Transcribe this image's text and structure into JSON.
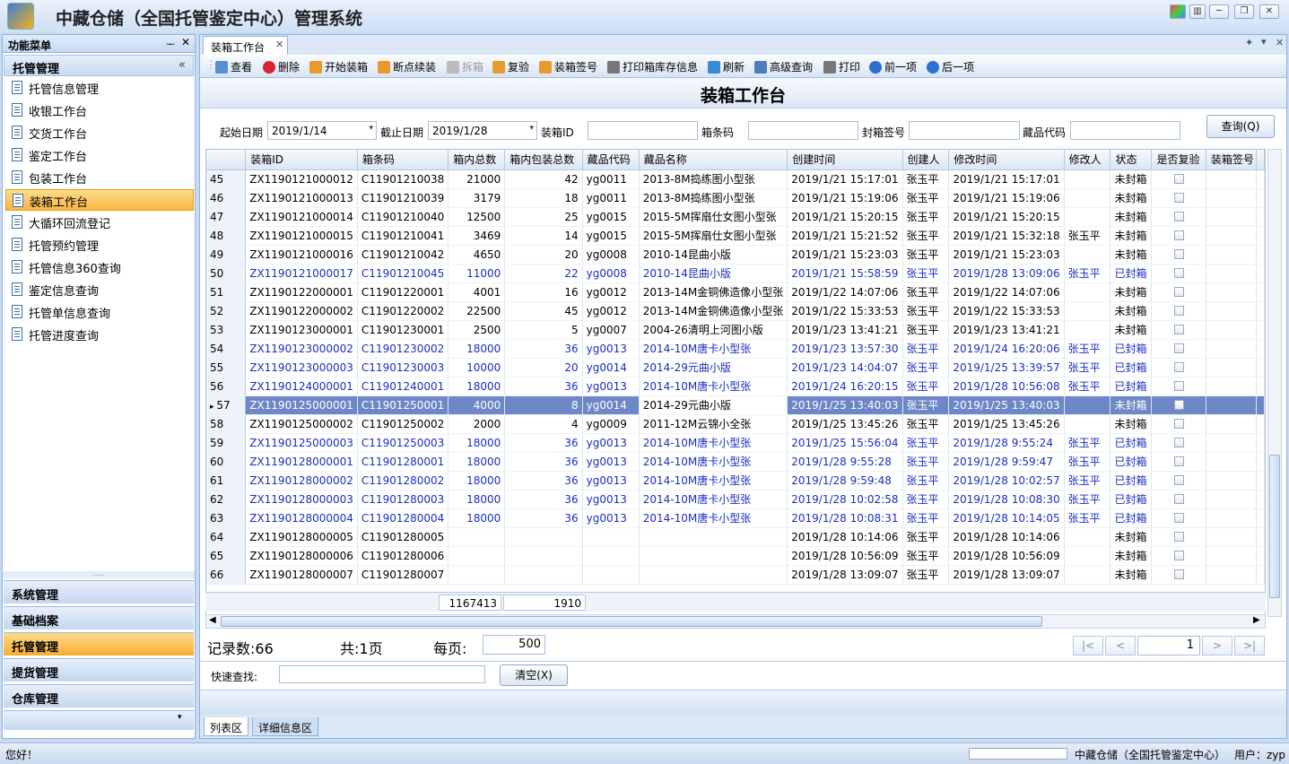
{
  "window": {
    "title": "中藏仓储（全国托管鉴定中心）管理系统"
  },
  "left_panel": {
    "header": "功能菜单",
    "group": "托管管理",
    "items": [
      "托管信息管理",
      "收银工作台",
      "交货工作台",
      "鉴定工作台",
      "包装工作台",
      "装箱工作台",
      "大循环回流登记",
      "托管预约管理",
      "托管信息360查询",
      "鉴定信息查询",
      "托管单信息查询",
      "托管进度查询"
    ],
    "active_index": 5,
    "bottom_groups": [
      "系统管理",
      "基础档案",
      "托管管理",
      "提货管理",
      "仓库管理"
    ]
  },
  "doc_tab": {
    "label": "装箱工作台"
  },
  "toolbar": {
    "query": "查看",
    "delete": "删除",
    "start": "开始装箱",
    "resume": "断点续装",
    "unpack": "拆箱",
    "recheck": "复验",
    "seal": "装箱签号",
    "print_stock": "打印箱库存信息",
    "refresh": "刷新",
    "advanced": "高级查询",
    "print": "打印",
    "prev": "前一项",
    "next": "后一项"
  },
  "heading": "装箱工作台",
  "filters": {
    "start_label": "起始日期",
    "start_value": "2019/1/14",
    "end_label": "截止日期",
    "end_value": "2019/1/28",
    "box_id_label": "装箱ID",
    "barcode_label": "箱条码",
    "seal_label": "封箱签号",
    "code_label": "藏品代码",
    "query_button": "查询(Q)"
  },
  "table": {
    "columns": [
      "装箱ID",
      "箱条码",
      "箱内总数",
      "箱内包装总数",
      "藏品代码",
      "藏品名称",
      "创建时间",
      "创建人",
      "修改时间",
      "修改人",
      "状态",
      "是否复验",
      "装箱签号"
    ],
    "rows": [
      [
        "45",
        "ZX1190121000012",
        "C11901210038",
        "21000",
        "42",
        "yg0011",
        "2013-8M捣练图小型张",
        "2019/1/21 15:17:01",
        "张玉平",
        "2019/1/21 15:17:01",
        "",
        "未封箱"
      ],
      [
        "46",
        "ZX1190121000013",
        "C11901210039",
        "3179",
        "18",
        "yg0011",
        "2013-8M捣练图小型张",
        "2019/1/21 15:19:06",
        "张玉平",
        "2019/1/21 15:19:06",
        "",
        "未封箱"
      ],
      [
        "47",
        "ZX1190121000014",
        "C11901210040",
        "12500",
        "25",
        "yg0015",
        "2015-5M挥扇仕女图小型张",
        "2019/1/21 15:20:15",
        "张玉平",
        "2019/1/21 15:20:15",
        "",
        "未封箱"
      ],
      [
        "48",
        "ZX1190121000015",
        "C11901210041",
        "3469",
        "14",
        "yg0015",
        "2015-5M挥扇仕女图小型张",
        "2019/1/21 15:21:52",
        "张玉平",
        "2019/1/21 15:32:18",
        "张玉平",
        "未封箱"
      ],
      [
        "49",
        "ZX1190121000016",
        "C11901210042",
        "4650",
        "20",
        "yg0008",
        "2010-14昆曲小版",
        "2019/1/21 15:23:03",
        "张玉平",
        "2019/1/21 15:23:03",
        "",
        "未封箱"
      ],
      [
        "50",
        "ZX1190121000017",
        "C11901210045",
        "11000",
        "22",
        "yg0008",
        "2010-14昆曲小版",
        "2019/1/21 15:58:59",
        "张玉平",
        "2019/1/28 13:09:06",
        "张玉平",
        "已封箱"
      ],
      [
        "51",
        "ZX1190122000001",
        "C11901220001",
        "4001",
        "16",
        "yg0012",
        "2013-14M金铜佛造像小型张",
        "2019/1/22 14:07:06",
        "张玉平",
        "2019/1/22 14:07:06",
        "",
        "未封箱"
      ],
      [
        "52",
        "ZX1190122000002",
        "C11901220002",
        "22500",
        "45",
        "yg0012",
        "2013-14M金铜佛造像小型张",
        "2019/1/22 15:33:53",
        "张玉平",
        "2019/1/22 15:33:53",
        "",
        "未封箱"
      ],
      [
        "53",
        "ZX1190123000001",
        "C11901230001",
        "2500",
        "5",
        "yg0007",
        "2004-26清明上河图小版",
        "2019/1/23 13:41:21",
        "张玉平",
        "2019/1/23 13:41:21",
        "",
        "未封箱"
      ],
      [
        "54",
        "ZX1190123000002",
        "C11901230002",
        "18000",
        "36",
        "yg0013",
        "2014-10M唐卡小型张",
        "2019/1/23 13:57:30",
        "张玉平",
        "2019/1/24 16:20:06",
        "张玉平",
        "已封箱"
      ],
      [
        "55",
        "ZX1190123000003",
        "C11901230003",
        "10000",
        "20",
        "yg0014",
        "2014-29元曲小版",
        "2019/1/23 14:04:07",
        "张玉平",
        "2019/1/25 13:39:57",
        "张玉平",
        "已封箱"
      ],
      [
        "56",
        "ZX1190124000001",
        "C11901240001",
        "18000",
        "36",
        "yg0013",
        "2014-10M唐卡小型张",
        "2019/1/24 16:20:15",
        "张玉平",
        "2019/1/28 10:56:08",
        "张玉平",
        "已封箱"
      ],
      [
        "57",
        "ZX1190125000001",
        "C11901250001",
        "4000",
        "8",
        "yg0014",
        "2014-29元曲小版",
        "2019/1/25 13:40:03",
        "张玉平",
        "2019/1/25 13:40:03",
        "",
        "未封箱"
      ],
      [
        "58",
        "ZX1190125000002",
        "C11901250002",
        "2000",
        "4",
        "yg0009",
        "2011-12M云锦小全张",
        "2019/1/25 13:45:26",
        "张玉平",
        "2019/1/25 13:45:26",
        "",
        "未封箱"
      ],
      [
        "59",
        "ZX1190125000003",
        "C11901250003",
        "18000",
        "36",
        "yg0013",
        "2014-10M唐卡小型张",
        "2019/1/25 15:56:04",
        "张玉平",
        "2019/1/28 9:55:24",
        "张玉平",
        "已封箱"
      ],
      [
        "60",
        "ZX1190128000001",
        "C11901280001",
        "18000",
        "36",
        "yg0013",
        "2014-10M唐卡小型张",
        "2019/1/28 9:55:28",
        "张玉平",
        "2019/1/28 9:59:47",
        "张玉平",
        "已封箱"
      ],
      [
        "61",
        "ZX1190128000002",
        "C11901280002",
        "18000",
        "36",
        "yg0013",
        "2014-10M唐卡小型张",
        "2019/1/28 9:59:48",
        "张玉平",
        "2019/1/28 10:02:57",
        "张玉平",
        "已封箱"
      ],
      [
        "62",
        "ZX1190128000003",
        "C11901280003",
        "18000",
        "36",
        "yg0013",
        "2014-10M唐卡小型张",
        "2019/1/28 10:02:58",
        "张玉平",
        "2019/1/28 10:08:30",
        "张玉平",
        "已封箱"
      ],
      [
        "63",
        "ZX1190128000004",
        "C11901280004",
        "18000",
        "36",
        "yg0013",
        "2014-10M唐卡小型张",
        "2019/1/28 10:08:31",
        "张玉平",
        "2019/1/28 10:14:05",
        "张玉平",
        "已封箱"
      ],
      [
        "64",
        "ZX1190128000005",
        "C11901280005",
        "",
        "",
        "",
        "",
        "2019/1/28 10:14:06",
        "张玉平",
        "2019/1/28 10:14:06",
        "",
        "未封箱"
      ],
      [
        "65",
        "ZX1190128000006",
        "C11901280006",
        "",
        "",
        "",
        "",
        "2019/1/28 10:56:09",
        "张玉平",
        "2019/1/28 10:56:09",
        "",
        "未封箱"
      ],
      [
        "66",
        "ZX1190128000007",
        "C11901280007",
        "",
        "",
        "",
        "",
        "2019/1/28 13:09:07",
        "张玉平",
        "2019/1/28 13:09:07",
        "",
        "未封箱"
      ]
    ],
    "selected_row": "57",
    "sum_total": "1167413",
    "sum_packages": "1910"
  },
  "pager": {
    "records": "记录数:66",
    "pages": "共:1页",
    "per_page_label": "每页:",
    "per_page": "500",
    "current_page": "1",
    "first": "|<",
    "prev": "<",
    "next": ">",
    "last": ">|"
  },
  "quick_search": {
    "label": "快速查找:",
    "clear": "清空(X)"
  },
  "bottom_tabs": [
    "列表区",
    "详细信息区"
  ],
  "status": {
    "greeting": "您好！",
    "company": "中藏仓储（全国托管鉴定中心）",
    "user": "用户：zyp"
  },
  "colors": {
    "accent": "#f8b743",
    "selected_row": "#6d87c7",
    "sealed_text": "#1a2fbf"
  }
}
